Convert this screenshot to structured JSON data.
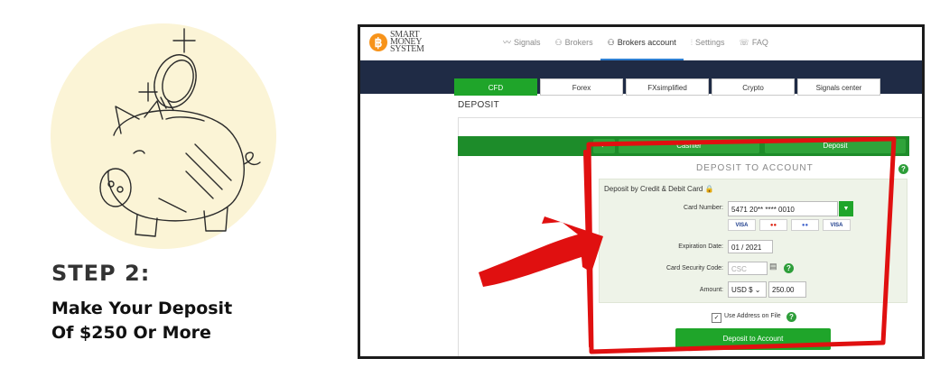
{
  "left": {
    "step_title": "STEP 2:",
    "step_line1": "Make Your Deposit",
    "step_line2": "Of $250 Or More"
  },
  "app": {
    "logo_lines": [
      "SMART",
      "MONEY",
      "SYSTEM"
    ],
    "nav": [
      {
        "label": "Signals",
        "icon": "chart-line-icon"
      },
      {
        "label": "Brokers",
        "icon": "user-icon"
      },
      {
        "label": "Brokers account",
        "icon": "user-icon",
        "active": true
      },
      {
        "label": "Settings",
        "icon": "sliders-icon"
      },
      {
        "label": "FAQ",
        "icon": "chat-icon"
      }
    ],
    "tabs": [
      "CFD",
      "Forex",
      "FXsimplified",
      "Crypto",
      "Signals center"
    ],
    "section_label": "DEPOSIT",
    "greenbar_buttons": [
      "Cashier",
      "Deposit"
    ],
    "deposit_title": "DEPOSIT TO ACCOUNT",
    "panel_title": "Deposit by Credit & Debit Card",
    "form": {
      "card_number_label": "Card Number:",
      "card_number_value": "5471 20** **** 0010",
      "expiration_label": "Expiration Date:",
      "expiration_value": "01 / 2021",
      "csc_label": "Card Security Code:",
      "csc_placeholder": "CSC",
      "amount_label": "Amount:",
      "currency_value": "USD $",
      "amount_value": "250.00"
    },
    "card_brands": [
      "VISA",
      "mastercard",
      "maestro",
      "VISA"
    ],
    "use_address_label": "Use Address on File",
    "use_address_checked": true,
    "submit_label": "Deposit to Account",
    "colors": {
      "accent_green": "#1fa52a",
      "dark_band": "#1f2b45",
      "highlight_red": "#e01010",
      "brand_orange": "#f7931a"
    }
  }
}
